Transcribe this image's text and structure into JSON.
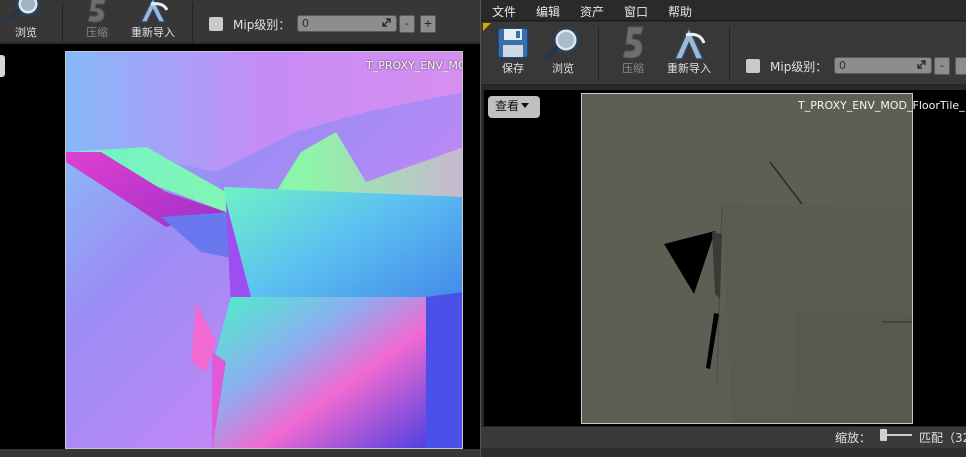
{
  "left_window": {
    "toolbar": {
      "browse_label": "浏览",
      "compress_label": "压缩",
      "reimport_label": "重新导入"
    },
    "mip": {
      "label": "Mip级别：",
      "value": "0",
      "minus": "-",
      "plus": "+"
    },
    "texture_name": "T_PROXY_ENV_MOD"
  },
  "right_window": {
    "menu": [
      "文件",
      "编辑",
      "资产",
      "窗口",
      "帮助"
    ],
    "toolbar": {
      "save_label": "保存",
      "browse_label": "浏览",
      "compress_label": "压缩",
      "reimport_label": "重新导入"
    },
    "mip": {
      "label": "Mip级别：",
      "value": "0",
      "minus": "-"
    },
    "view_menu_label": "查看",
    "texture_name": "T_PROXY_ENV_MOD_FloorTile_",
    "status": {
      "zoom_label": "缩放：",
      "fit_label": "匹配（32"
    }
  },
  "colors": {
    "toolbar_bg": "#383838",
    "viewport_bg": "#000000",
    "accent_corner": "#d8a800",
    "texture_gray": "#5f5e54"
  }
}
